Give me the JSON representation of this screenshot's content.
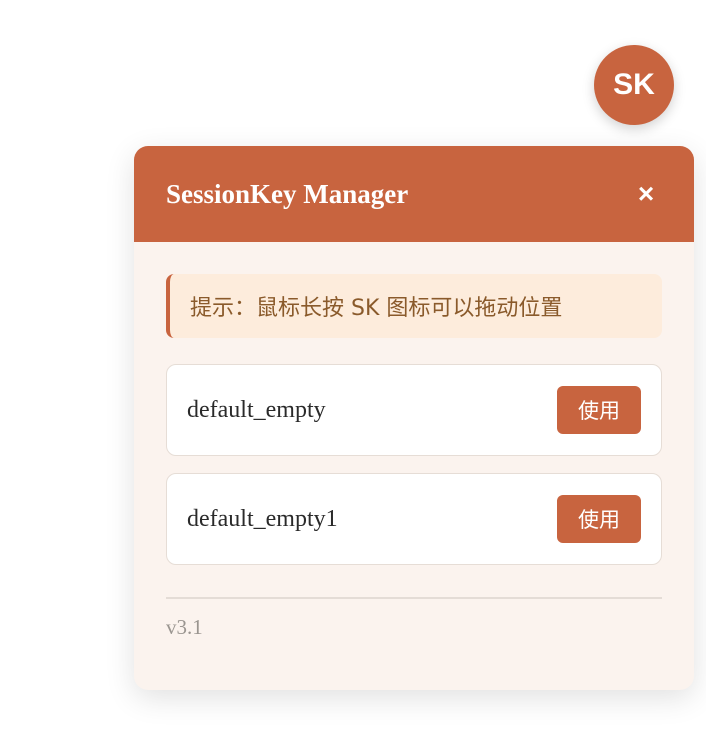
{
  "fab": {
    "label": "SK"
  },
  "panel": {
    "title": "SessionKey Manager",
    "close_label": "×",
    "hint": "提示：鼠标长按 SK 图标可以拖动位置",
    "sessions": [
      {
        "name": "default_empty",
        "button": "使用"
      },
      {
        "name": "default_empty1",
        "button": "使用"
      }
    ],
    "version": "v3.1"
  },
  "colors": {
    "accent": "#c8643f",
    "panel_bg": "#fbf3ee",
    "hint_bg": "#fdecdc",
    "hint_text": "#8a5a2b"
  }
}
